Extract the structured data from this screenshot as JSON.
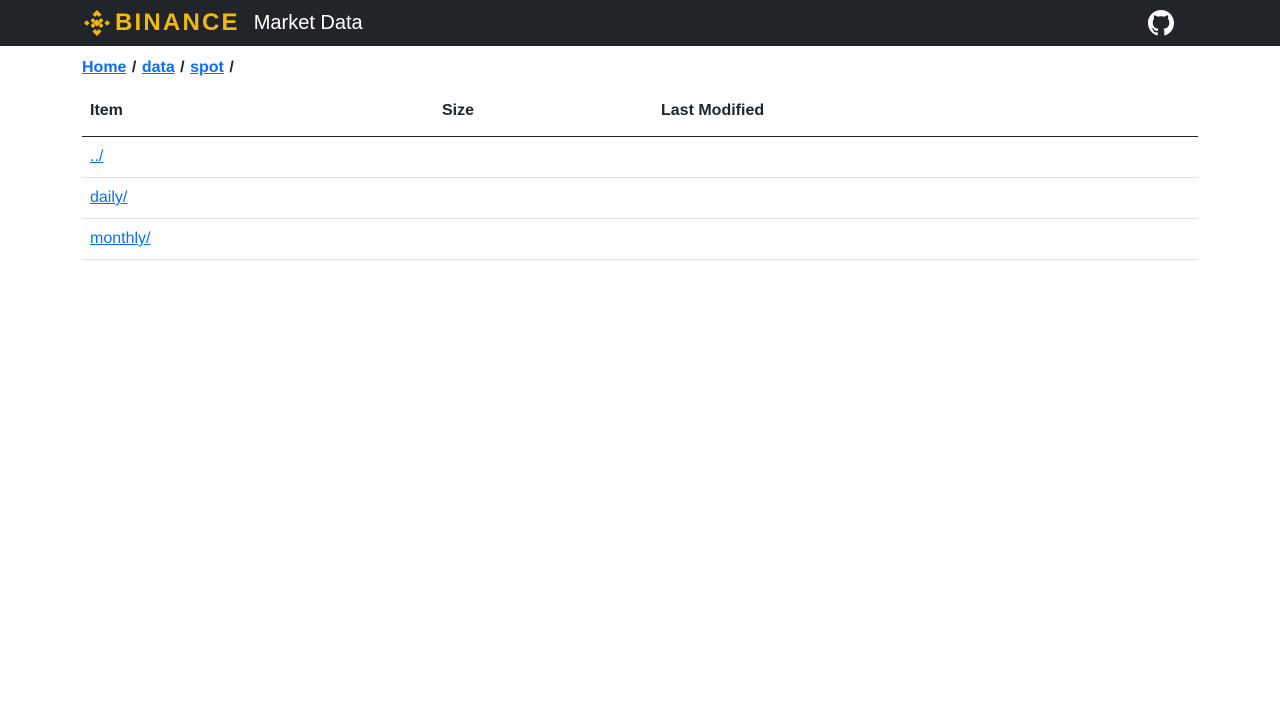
{
  "header": {
    "logo_text": "BINANCE",
    "title": "Market Data",
    "brand_color": "#F0B90B",
    "github_icon": "github-icon"
  },
  "breadcrumb": {
    "items": [
      {
        "label": "Home"
      },
      {
        "label": "data"
      },
      {
        "label": "spot"
      }
    ],
    "separator": "/"
  },
  "table": {
    "columns": [
      "Item",
      "Size",
      "Last Modified"
    ],
    "rows": [
      {
        "item": "../",
        "size": "",
        "modified": ""
      },
      {
        "item": "daily/",
        "size": "",
        "modified": ""
      },
      {
        "item": "monthly/",
        "size": "",
        "modified": ""
      }
    ]
  }
}
